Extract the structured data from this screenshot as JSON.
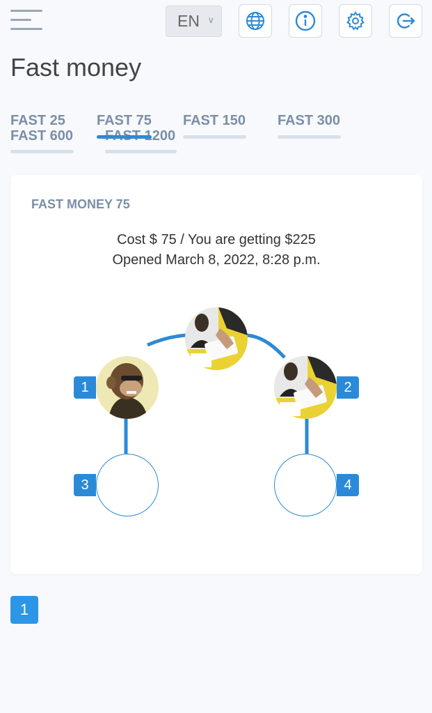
{
  "header": {
    "language": "EN",
    "icons": [
      "menu-icon",
      "globe-icon",
      "info-icon",
      "gear-icon",
      "logout-icon"
    ]
  },
  "page": {
    "title": "Fast money"
  },
  "tabs": [
    {
      "label": "FAST 25",
      "active": false
    },
    {
      "label": "FAST 75",
      "active": true
    },
    {
      "label": "FAST 150",
      "active": false
    },
    {
      "label": "FAST 300",
      "active": false
    },
    {
      "label": "FAST 600",
      "active": false
    },
    {
      "label": "FAST 1200",
      "active": false
    }
  ],
  "card": {
    "title": "FAST MONEY 75",
    "cost_line": "Cost $ 75 / You are getting $225",
    "opened_line": "Opened March 8, 2022, 8:28 p.m."
  },
  "tree": {
    "slots": [
      {
        "number": "1",
        "filled": true
      },
      {
        "number": "2",
        "filled": true
      },
      {
        "number": "3",
        "filled": false
      },
      {
        "number": "4",
        "filled": false
      }
    ]
  },
  "pagination": {
    "current": "1"
  },
  "colors": {
    "accent": "#2b8ad8",
    "tab_text": "#7b8ea6",
    "background": "#f7f9fc"
  }
}
